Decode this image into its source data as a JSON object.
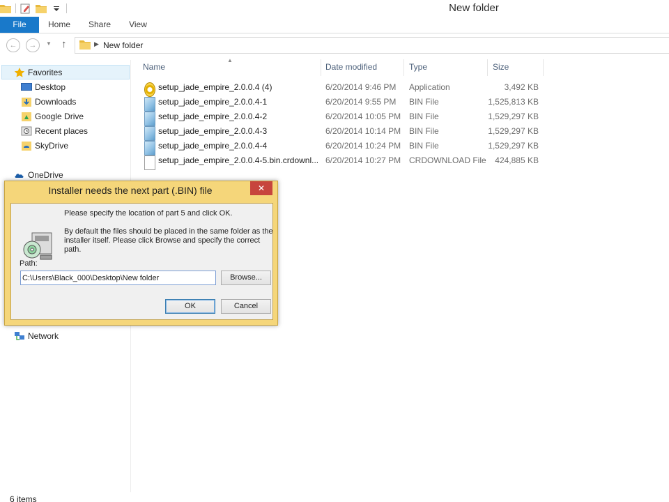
{
  "window": {
    "title": "New folder"
  },
  "ribbon": {
    "tabs": [
      {
        "label": "File"
      },
      {
        "label": "Home"
      },
      {
        "label": "Share"
      },
      {
        "label": "View"
      }
    ]
  },
  "address": {
    "path": "New folder"
  },
  "navigation": {
    "favorites_label": "Favorites",
    "favorites": [
      {
        "label": "Desktop",
        "icon": "desktop-icon"
      },
      {
        "label": "Downloads",
        "icon": "downloads-folder-icon"
      },
      {
        "label": "Google Drive",
        "icon": "google-drive-folder-icon"
      },
      {
        "label": "Recent places",
        "icon": "recent-places-icon"
      },
      {
        "label": "SkyDrive",
        "icon": "skydrive-folder-icon"
      }
    ],
    "onedrive_label": "OneDrive",
    "network_label": "Network"
  },
  "file_list": {
    "columns": {
      "name": "Name",
      "date": "Date modified",
      "type": "Type",
      "size": "Size"
    },
    "rows": [
      {
        "name": "setup_jade_empire_2.0.0.4 (4)",
        "date": "6/20/2014 9:46 PM",
        "type": "Application",
        "size": "3,492 KB",
        "icon": "application-icon"
      },
      {
        "name": "setup_jade_empire_2.0.0.4-1",
        "date": "6/20/2014 9:55 PM",
        "type": "BIN File",
        "size": "1,525,813 KB",
        "icon": "bin-file-icon"
      },
      {
        "name": "setup_jade_empire_2.0.0.4-2",
        "date": "6/20/2014 10:05 PM",
        "type": "BIN File",
        "size": "1,529,297 KB",
        "icon": "bin-file-icon"
      },
      {
        "name": "setup_jade_empire_2.0.0.4-3",
        "date": "6/20/2014 10:14 PM",
        "type": "BIN File",
        "size": "1,529,297 KB",
        "icon": "bin-file-icon"
      },
      {
        "name": "setup_jade_empire_2.0.0.4-4",
        "date": "6/20/2014 10:24 PM",
        "type": "BIN File",
        "size": "1,529,297 KB",
        "icon": "bin-file-icon"
      },
      {
        "name": "setup_jade_empire_2.0.0.4-5.bin.crdownl...",
        "date": "6/20/2014 10:27 PM",
        "type": "CRDOWNLOAD File",
        "size": "424,885 KB",
        "icon": "crdownload-file-icon"
      }
    ]
  },
  "status": {
    "item_count": "6 items"
  },
  "dialog": {
    "title": "Installer needs the next part (.BIN) file",
    "message1": "Please specify the location of part 5 and click OK.",
    "message2": "By default the files should be placed in the same folder as the installer itself. Please click Browse and specify the correct path.",
    "path_label": "Path:",
    "path_value": "C:\\Users\\Black_000\\Desktop\\New folder",
    "browse_label": "Browse...",
    "ok_label": "OK",
    "cancel_label": "Cancel",
    "close_glyph": "✕"
  }
}
